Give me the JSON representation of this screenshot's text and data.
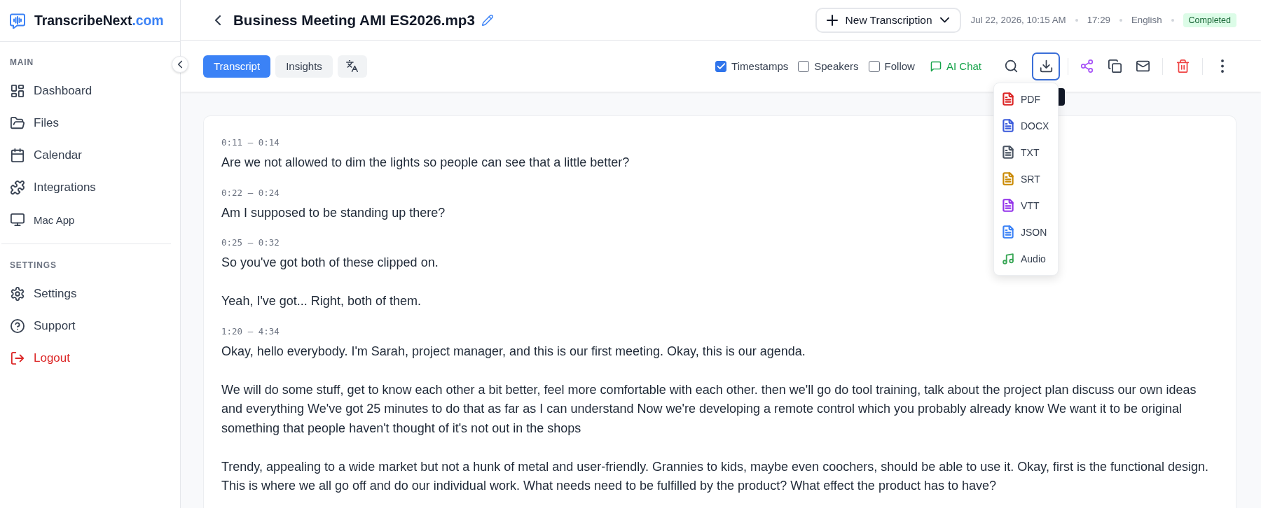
{
  "sidebar": {
    "logo": {
      "name": "TranscribeNext",
      "suffix": ".com"
    },
    "sections": [
      {
        "title": "MAIN",
        "items": [
          {
            "label": "Dashboard",
            "kind": "page",
            "selected": false
          },
          {
            "label": "Files",
            "kind": "page",
            "selected": false
          },
          {
            "label": "Calendar",
            "kind": "page",
            "selected": false
          },
          {
            "label": "Integrations",
            "kind": "page",
            "selected": false
          },
          {
            "label": "Mac App",
            "kind": "app",
            "selected": false
          }
        ]
      },
      {
        "title": "SETTINGS",
        "items": [
          {
            "label": "Settings",
            "kind": "page",
            "selected": false
          },
          {
            "label": "Support",
            "kind": "page",
            "selected": false
          },
          {
            "label": "Logout",
            "kind": "logout",
            "selected": false
          }
        ]
      }
    ]
  },
  "header": {
    "title": "Business Meeting AMI ES2026.mp3",
    "new_button": "New Transcription",
    "meta": [
      "Jul 22, 2026, 10:15 AM",
      "17:29",
      "English"
    ],
    "status": "Completed"
  },
  "toolbar": {
    "tabs": [
      {
        "kind": "text",
        "label": "Transcript",
        "selected": true
      },
      {
        "kind": "text",
        "label": "Insights",
        "selected": false
      },
      {
        "kind": "icon",
        "selected": false
      }
    ],
    "options": [
      {
        "label": "Timestamps",
        "checked": true
      },
      {
        "label": "Speakers",
        "checked": false
      },
      {
        "label": "Follow",
        "checked": false
      }
    ],
    "ai_chat": "AI Chat",
    "export_menu": {
      "expanded": true,
      "items": [
        {
          "label": "PDF",
          "kind": "document",
          "color": "#dc2626"
        },
        {
          "label": "DOCX",
          "kind": "document",
          "color": "#3b5bdb"
        },
        {
          "label": "TXT",
          "kind": "document",
          "color": "#4b5563"
        },
        {
          "label": "SRT",
          "kind": "document",
          "color": "#ca8a04"
        },
        {
          "label": "VTT",
          "kind": "document",
          "color": "#9333ea"
        },
        {
          "label": "JSON",
          "kind": "document",
          "color": "#3b82f6"
        },
        {
          "label": "Audio",
          "kind": "audio",
          "color": "#3aa757"
        }
      ]
    }
  },
  "transcript": {
    "segments": [
      {
        "time": "0:11 – 0:14",
        "paragraphs": [
          "Are we not allowed to dim the lights so people can see that a little better?"
        ]
      },
      {
        "time": "0:22 – 0:24",
        "paragraphs": [
          "Am I supposed to be standing up there?"
        ]
      },
      {
        "time": "0:25 – 0:32",
        "paragraphs": [
          "So you've got both of these clipped on.",
          "Yeah, I've got... Right, both of them."
        ]
      },
      {
        "time": "1:20 – 4:34",
        "paragraphs": [
          "Okay, hello everybody. I'm Sarah, project manager, and this is our first meeting. Okay, this is our agenda.",
          "We will do some stuff, get to know each other a bit better, feel more comfortable with each other. then we'll go do tool training, talk about the project plan discuss our own ideas and everything We've got 25 minutes to do that as far as I can understand Now we're developing a remote control which you probably already know We want it to be original something that people haven't thought of it's not out in the shops",
          "Trendy, appealing to a wide market but not a hunk of metal and user-friendly. Grannies to kids, maybe even coochers, should be able to use it. Okay, first is the functional design. This is where we all go off and do our individual work. What needs need to be fulfilled by the product? What effect the product has to have?"
        ]
      }
    ]
  }
}
